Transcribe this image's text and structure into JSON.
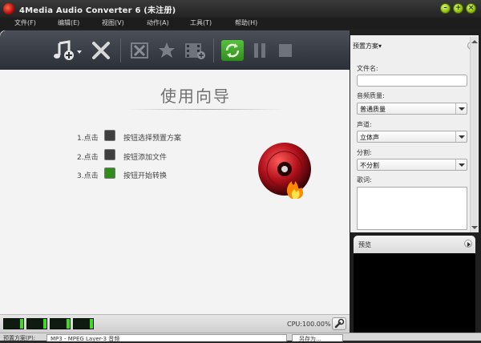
{
  "window": {
    "title": "4Media Audio Converter 6 (未注册)"
  },
  "menu": [
    "文件(F)",
    "编辑(E)",
    "视图(V)",
    "动作(A)",
    "工具(T)",
    "帮助(H)"
  ],
  "guide": {
    "title": "使用向导",
    "steps": [
      {
        "num": "1.点击",
        "text": "按钮选择预置方案"
      },
      {
        "num": "2.点击",
        "text": "按钮添加文件"
      },
      {
        "num": "3.点击",
        "text": "按钮开始转换"
      }
    ]
  },
  "status": {
    "cpu": "CPU:100.00%"
  },
  "right_panel": {
    "header": "预置方案▾",
    "filename_label": "文件名:",
    "filename_value": "",
    "quality_label": "音频质量:",
    "quality_value": "普通质量",
    "channel_label": "声道:",
    "channel_value": "立体声",
    "split_label": "分割:",
    "split_value": "不分割",
    "lyrics_label": "歌词:"
  },
  "preview": {
    "label": "预览"
  },
  "bottom": {
    "label": "预置方案(P):",
    "value": "MP3 - MPEG Layer-3 音频",
    "button": "另存为..."
  },
  "colors": {
    "toolbar_green": "#3fae2a",
    "meter_green": "#3ddc1c",
    "disc_red": "#c1121a"
  },
  "icons": [
    "add-music-icon",
    "delete-icon",
    "clip-icon",
    "effects-icon",
    "edit-video-icon",
    "convert-icon",
    "pause-icon",
    "stop-icon",
    "wrench-icon"
  ]
}
